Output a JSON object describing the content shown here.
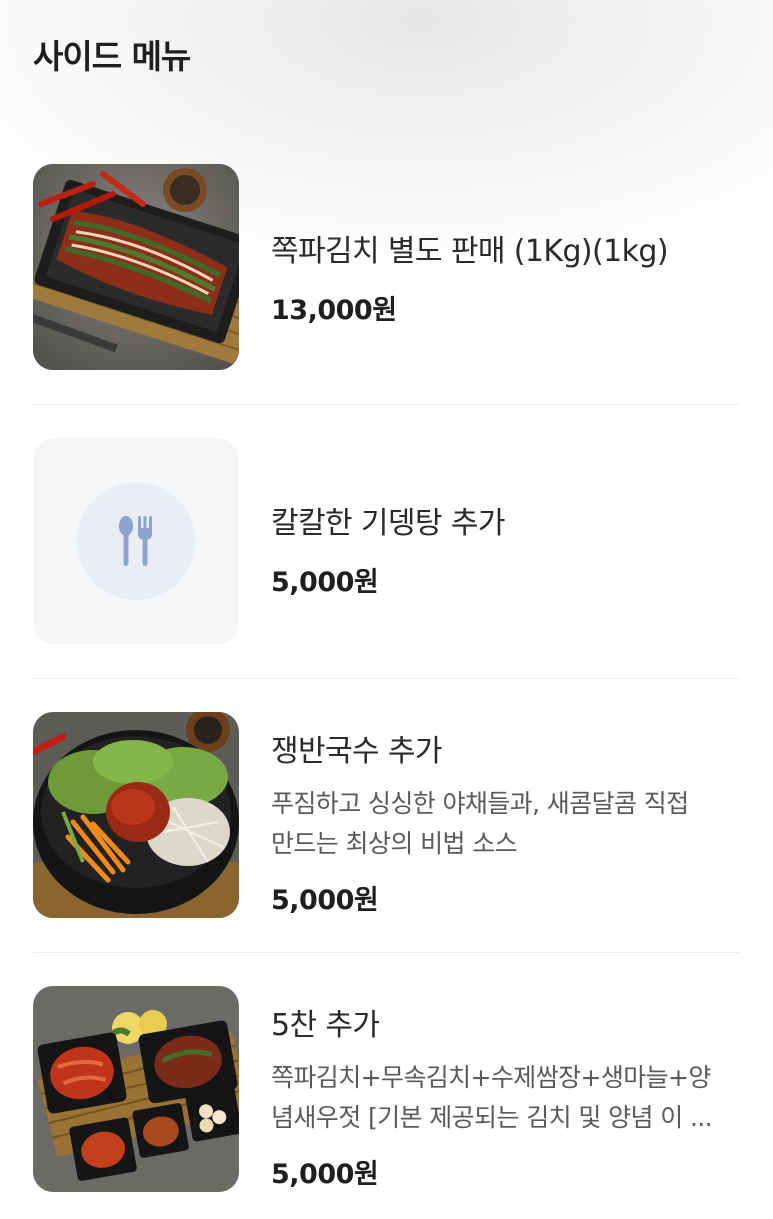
{
  "section": {
    "title": "사이드 메뉴"
  },
  "items": [
    {
      "name": "쪽파김치 별도 판매 (1Kg)(1kg)",
      "description": "",
      "price": "13,000원",
      "image": "green-onion-kimchi-photo"
    },
    {
      "name": "칼칼한 기뎅탕 추가",
      "description": "",
      "price": "5,000원",
      "image": "fork-spoon-icon"
    },
    {
      "name": "쟁반국수 추가",
      "description_lines": [
        "푸짐하고 싱싱한 야채들과, 새콤달콤 직접",
        "만드는 최상의 비법 소스"
      ],
      "price": "5,000원",
      "image": "spicy-noodles-photo"
    },
    {
      "name": "5찬 추가",
      "description_lines": [
        "쪽파김치+무속김치+수제쌈장+생마늘+양",
        "념새우젓 [기본 제공되는 김치 및 양념 이 ..."
      ],
      "price": "5,000원",
      "image": "five-side-dishes-photo"
    }
  ],
  "colors": {
    "placeholder_icon": "#8fa4cc",
    "placeholder_circle": "#e9edf4",
    "divider": "#ececec"
  }
}
